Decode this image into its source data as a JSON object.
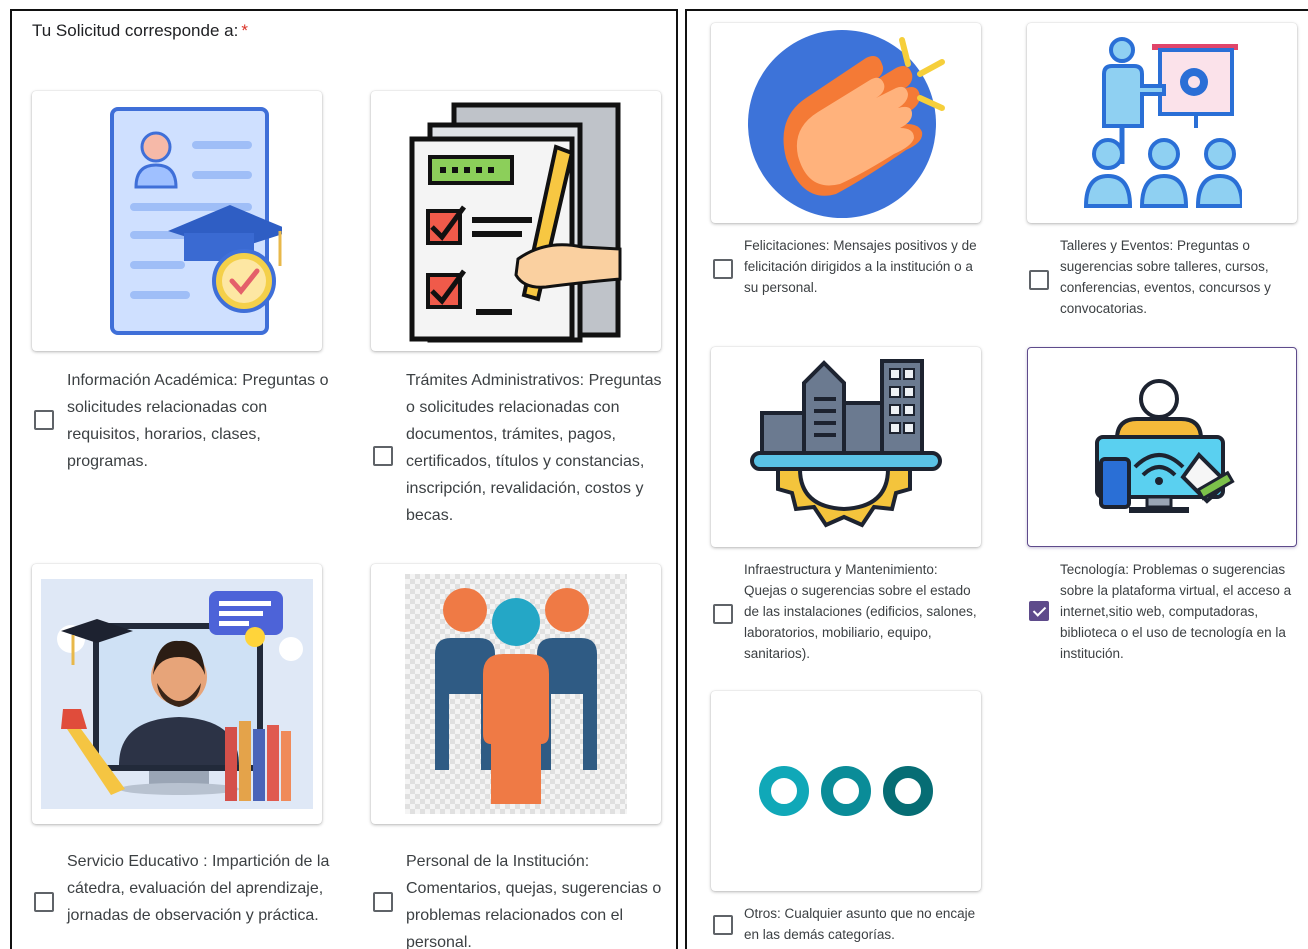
{
  "question": {
    "title": "Tu Solicitud corresponde a:",
    "required_mark": "*"
  },
  "options": [
    {
      "id": "informacion-academica",
      "label": "Información Académica: Preguntas o solicitudes relacionadas con requisitos, horarios, clases, programas.",
      "checked": false,
      "icon": "academic-certificate-icon"
    },
    {
      "id": "tramites-administrativos",
      "label": "Trámites Administrativos: Preguntas o solicitudes relacionadas con documentos, trámites, pagos, certificados, títulos y constancias,  inscripción, revalidación, costos y becas.",
      "checked": false,
      "icon": "checklist-document-icon"
    },
    {
      "id": "servicio-educativo",
      "label": "Servicio Educativo : Impartición de la cátedra, evaluación del aprendizaje, jornadas de observación y práctica.",
      "checked": false,
      "icon": "teacher-screen-icon"
    },
    {
      "id": "personal-institucion",
      "label": "Personal de la Institución: Comentarios, quejas, sugerencias o problemas relacionados con el personal.",
      "checked": false,
      "icon": "people-group-icon"
    },
    {
      "id": "felicitaciones",
      "label": "Felicitaciones: Mensajes positivos y de felicitación dirigidos a la institución o a su personal.",
      "checked": false,
      "icon": "clapping-hands-icon"
    },
    {
      "id": "talleres-eventos",
      "label": "Talleres y Eventos: Preguntas o sugerencias sobre talleres, cursos, conferencias, eventos, concursos y convocatorias.",
      "checked": false,
      "icon": "presentation-icon"
    },
    {
      "id": "infraestructura",
      "label": "Infraestructura y Mantenimiento: Quejas o sugerencias sobre el estado de las instalaciones (edificios, salones, laboratorios, mobiliario, equipo, sanitarios).",
      "checked": false,
      "icon": "building-gear-icon"
    },
    {
      "id": "tecnologia",
      "label": "Tecnología: Problemas o sugerencias sobre la plataforma virtual, el acceso a internet,sitio web, computadoras, biblioteca o el uso de tecnología en la institución.",
      "checked": true,
      "icon": "technology-devices-icon"
    },
    {
      "id": "otros",
      "label": "Otros: Cualquier asunto que no encaje en las demás categorías.",
      "checked": false,
      "icon": "three-circles-icon"
    }
  ],
  "colors": {
    "accent": "#5e4b8b",
    "required": "#d93025"
  }
}
